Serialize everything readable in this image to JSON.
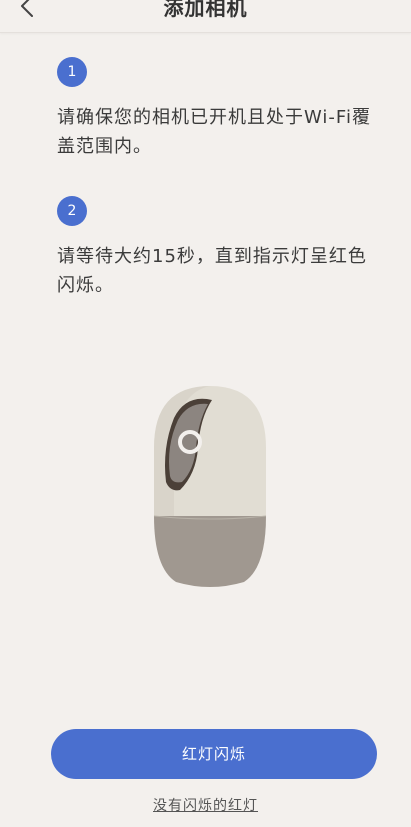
{
  "header": {
    "title": "添加相机",
    "back_icon": "chevron-left-icon"
  },
  "steps": [
    {
      "number": "1",
      "text": "请确保您的相机已开机且处于Wi-Fi覆盖范围内。"
    },
    {
      "number": "2",
      "text": "请等待大约15秒，直到指示灯呈红色闪烁。"
    }
  ],
  "actions": {
    "primary_label": "红灯闪烁",
    "secondary_link": "没有闪烁的红灯"
  },
  "colors": {
    "accent": "#4a6fcf",
    "background": "#f3f0ed"
  }
}
